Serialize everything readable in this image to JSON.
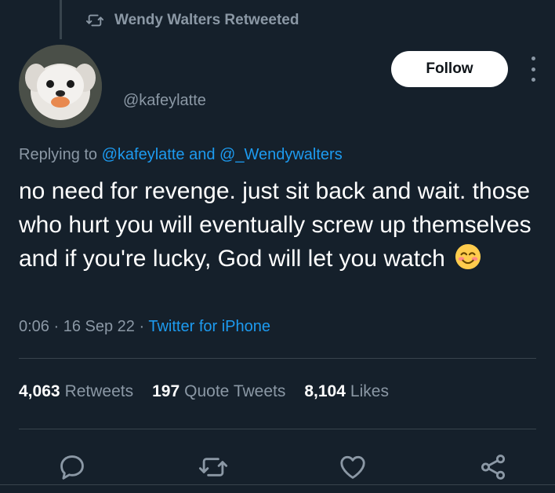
{
  "retweet_context": {
    "text": "Wendy Walters Retweeted",
    "icon": "retweet-icon"
  },
  "author": {
    "handle": "@kafeylatte",
    "avatar": "dog-avatar"
  },
  "follow_button": {
    "label": "Follow"
  },
  "reply_context": {
    "prefix": "Replying to",
    "mention1": "@kafeylatte",
    "conjunction": "and",
    "mention2": "@_Wendywalters"
  },
  "tweet": {
    "text": "no need for revenge. just sit back and wait. those who hurt you will eventually screw up themselves and if you're lucky, God will let you watch",
    "emoji": "smiling-face-emoji"
  },
  "meta": {
    "time": "0:06",
    "separator": "·",
    "date": "16 Sep 22",
    "source": "Twitter for iPhone"
  },
  "stats": {
    "retweets_count": "4,063",
    "retweets_label": "Retweets",
    "quotes_count": "197",
    "quotes_label": "Quote Tweets",
    "likes_count": "8,104",
    "likes_label": "Likes"
  },
  "actions": [
    "reply-icon",
    "retweet-icon",
    "like-icon",
    "share-icon"
  ],
  "colors": {
    "background": "#15202b",
    "accent": "#1d9bf0",
    "muted": "#8b98a5"
  }
}
